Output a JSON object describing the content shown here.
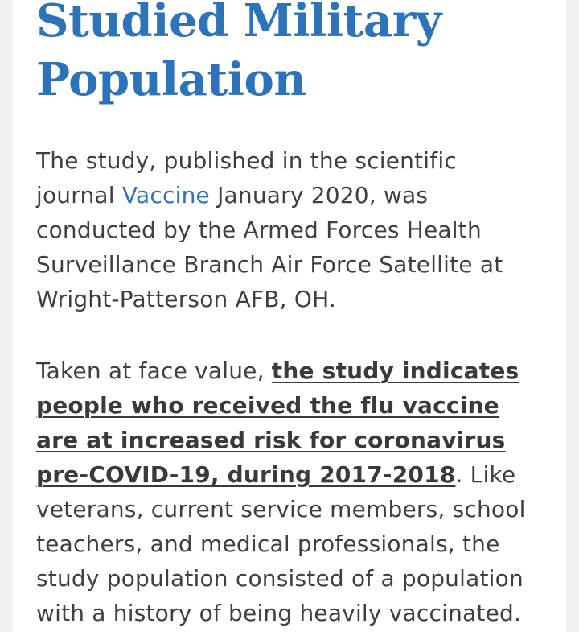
{
  "article": {
    "heading_line1": "Studied Military",
    "heading_line2": "Population",
    "paragraph1": {
      "before_link": "The study, published in the scientific journal ",
      "link_text": "Vaccine",
      "after_link": " January 2020, was conducted by the Armed Forces Health Surveillance Branch Air Force Satellite at Wright-Patterson AFB, OH."
    },
    "paragraph2": {
      "before_link": "Taken at face value, ",
      "link_text": "the study indicates people who received the flu vaccine are at increased risk for coronavirus pre-COVID-19, during 2017-2018",
      "after_link": ". Like veterans, current service members, school teachers, and medical professionals, the study population consisted of a population with a history of being heavily vaccinated."
    }
  },
  "colors": {
    "heading": "#2d73b9",
    "link": "#2d73b9",
    "body_text": "#3f3f3f",
    "page_background": "#f1f1f1",
    "card_background": "#ffffff"
  }
}
